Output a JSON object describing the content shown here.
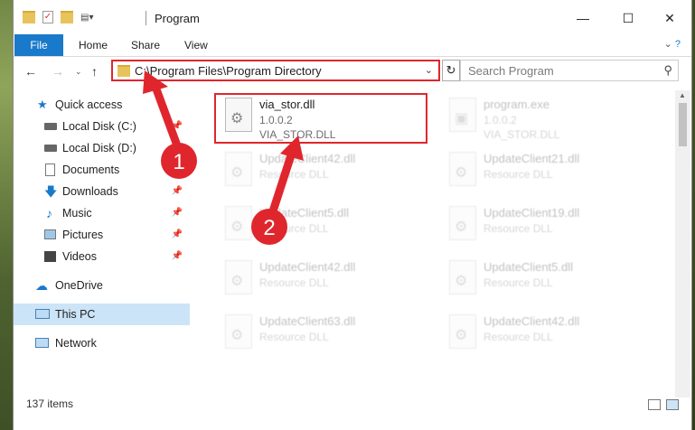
{
  "window": {
    "title": "Program"
  },
  "ribbon": {
    "file": "File",
    "home": "Home",
    "share": "Share",
    "view": "View"
  },
  "address": {
    "path": "C:\\Program Files\\Program Directory"
  },
  "search": {
    "placeholder": "Search Program"
  },
  "sidebar": {
    "items": [
      {
        "label": "Quick access"
      },
      {
        "label": "Local Disk (C:)"
      },
      {
        "label": "Local Disk (D:)"
      },
      {
        "label": "Documents"
      },
      {
        "label": "Downloads"
      },
      {
        "label": "Music"
      },
      {
        "label": "Pictures"
      },
      {
        "label": "Videos"
      },
      {
        "label": "OneDrive"
      },
      {
        "label": "This PC"
      },
      {
        "label": "Network"
      }
    ]
  },
  "files": [
    {
      "name": "via_stor.dll",
      "line2": "1.0.0.2",
      "line3": "VIA_STOR.DLL"
    },
    {
      "name": "program.exe",
      "line2": "1.0.0.2",
      "line3": "VIA_STOR.DLL"
    },
    {
      "name": "UpdateClient42.dll",
      "line2": "Resource DLL"
    },
    {
      "name": "UpdateClient21.dll",
      "line2": "Resource DLL"
    },
    {
      "name": "UpdateClient5.dll",
      "line2": "Resource DLL"
    },
    {
      "name": "UpdateClient19.dll",
      "line2": "Resource DLL"
    },
    {
      "name": "UpdateClient42.dll",
      "line2": "Resource DLL"
    },
    {
      "name": "UpdateClient5.dll",
      "line2": "Resource DLL"
    },
    {
      "name": "UpdateClient63.dll",
      "line2": "Resource DLL"
    },
    {
      "name": "UpdateClient42.dll",
      "line2": "Resource DLL"
    }
  ],
  "status": {
    "items": "137 items"
  },
  "annotations": {
    "step1": "1",
    "step2": "2"
  },
  "colors": {
    "accent": "#1979ca",
    "highlight": "#e0262d"
  }
}
